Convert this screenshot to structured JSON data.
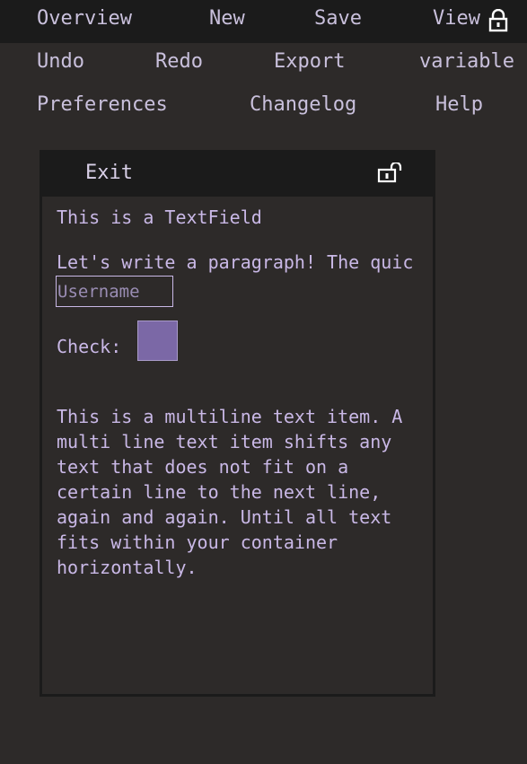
{
  "menu": {
    "row1": [
      "Overview",
      "New",
      "Save",
      "View"
    ],
    "row2": [
      "Undo",
      "Redo",
      "Export",
      "variable"
    ],
    "row3": [
      "Preferences",
      "Changelog",
      "Help"
    ]
  },
  "window": {
    "title": "Exit",
    "lock_icon": "unlocked-padlock-icon"
  },
  "top_lock_icon": "locked-padlock-icon",
  "content": {
    "textfield_label": "This is a TextField",
    "paragraph": "Let's write a paragraph! The quic",
    "username_placeholder": "Username",
    "check_label": "Check:",
    "multiline_text": "This is a multiline text item. A\nmulti line text item shifts any\ntext that does not fit on a\ncertain line to the next line,\nagain and again. Until all text\nfits within your container\nhorizontally."
  },
  "colors": {
    "background": "#2d2a29",
    "menubar": "#1b1b1b",
    "menu_text": "#c9c0dc",
    "accent_text": "#c9b8e6",
    "checkbox_fill": "#7b68a6"
  }
}
